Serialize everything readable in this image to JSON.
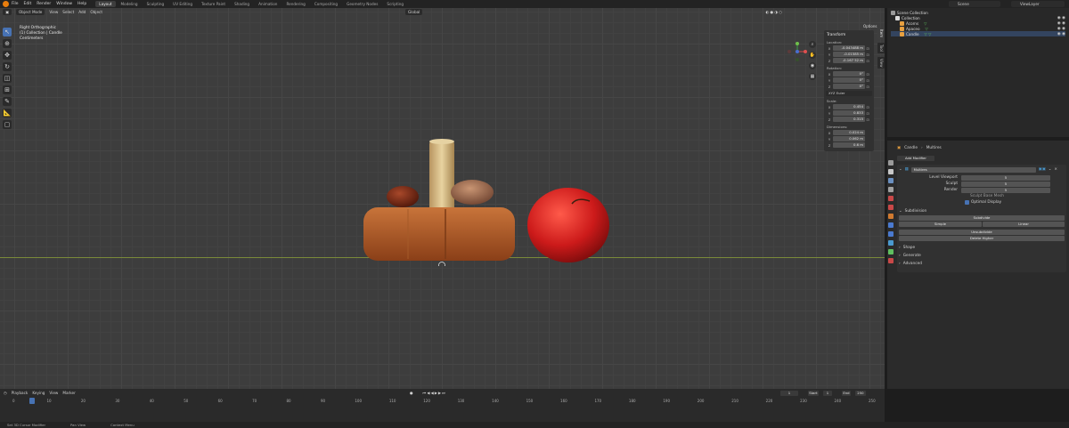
{
  "topbar": {
    "menu": [
      "File",
      "Edit",
      "Render",
      "Window",
      "Help"
    ],
    "workspaces": [
      "Layout",
      "Modeling",
      "Sculpting",
      "UV Editing",
      "Texture Paint",
      "Shading",
      "Animation",
      "Rendering",
      "Compositing",
      "Geometry Nodes",
      "Scripting"
    ],
    "active_workspace": "Layout",
    "scene": "Scene",
    "view_layer": "ViewLayer"
  },
  "viewport": {
    "mode": "Object Mode",
    "menus": [
      "View",
      "Select",
      "Add",
      "Object"
    ],
    "orientation": "Global",
    "options_label": "Options",
    "info": [
      "Right Orthographic",
      "(1) Collection | Candle",
      "Centimeters"
    ]
  },
  "npanel": {
    "tabs": [
      "Item",
      "Tool",
      "View"
    ],
    "title": "Transform",
    "location_label": "Location:",
    "location": [
      "-0.043488 m",
      "-0.01585 m",
      "-0.167 52 m"
    ],
    "rotation_label": "Rotation:",
    "rotation": [
      "0°",
      "0°",
      "0°"
    ],
    "rotation_mode": "XYZ Euler",
    "scale_label": "Scale:",
    "scale": [
      "0.454",
      "0.833",
      "0.315"
    ],
    "dimensions_label": "Dimensions:",
    "dimensions": [
      "0.024 m",
      "0.062 m",
      "0.6 m"
    ],
    "axes": [
      "X",
      "Y",
      "Z"
    ]
  },
  "outliner": {
    "items": [
      {
        "label": "Scene Collection",
        "indent": 0,
        "color": "#9a9a9a"
      },
      {
        "label": "Collection",
        "indent": 1,
        "color": "#dcdcdc"
      },
      {
        "label": "Acorns",
        "indent": 2,
        "color": "#e8a040"
      },
      {
        "label": "Apaceo",
        "indent": 2,
        "color": "#e8a040"
      },
      {
        "label": "Candle",
        "indent": 2,
        "color": "#e8a040"
      }
    ]
  },
  "properties": {
    "breadcrumb": [
      "Candle",
      "Multires"
    ],
    "add_modifier": "Add Modifier",
    "modifier_name": "Multires",
    "fields": [
      {
        "label": "Level Viewport",
        "value": "5"
      },
      {
        "label": "Sculpt",
        "value": "5"
      },
      {
        "label": "Render",
        "value": "5"
      }
    ],
    "sculpt_base_mesh": "Sculpt Base Mesh",
    "optimal_display": "Optimal Display",
    "subdivision_title": "Subdivision",
    "subdivide": "Subdivide",
    "simple": "Simple",
    "linear": "Linear",
    "unsubdivide": "Unsubdivide",
    "delete_higher": "Delete Higher",
    "sections": [
      "Shape",
      "Generate",
      "Advanced"
    ]
  },
  "timeline": {
    "menus": [
      "Playback",
      "Keying",
      "View",
      "Marker"
    ],
    "current_frame": "1",
    "start_label": "Start",
    "start": "1",
    "end_label": "End",
    "end": "250",
    "ruler": [
      "0",
      "10",
      "20",
      "30",
      "40",
      "50",
      "60",
      "70",
      "80",
      "90",
      "100",
      "110",
      "120",
      "130",
      "140",
      "150",
      "160",
      "170",
      "180",
      "190",
      "200",
      "210",
      "220",
      "230",
      "240",
      "250"
    ]
  },
  "statusbar": [
    "Set 3D Cursor Modifier",
    "Pan View",
    "Context Menu"
  ]
}
